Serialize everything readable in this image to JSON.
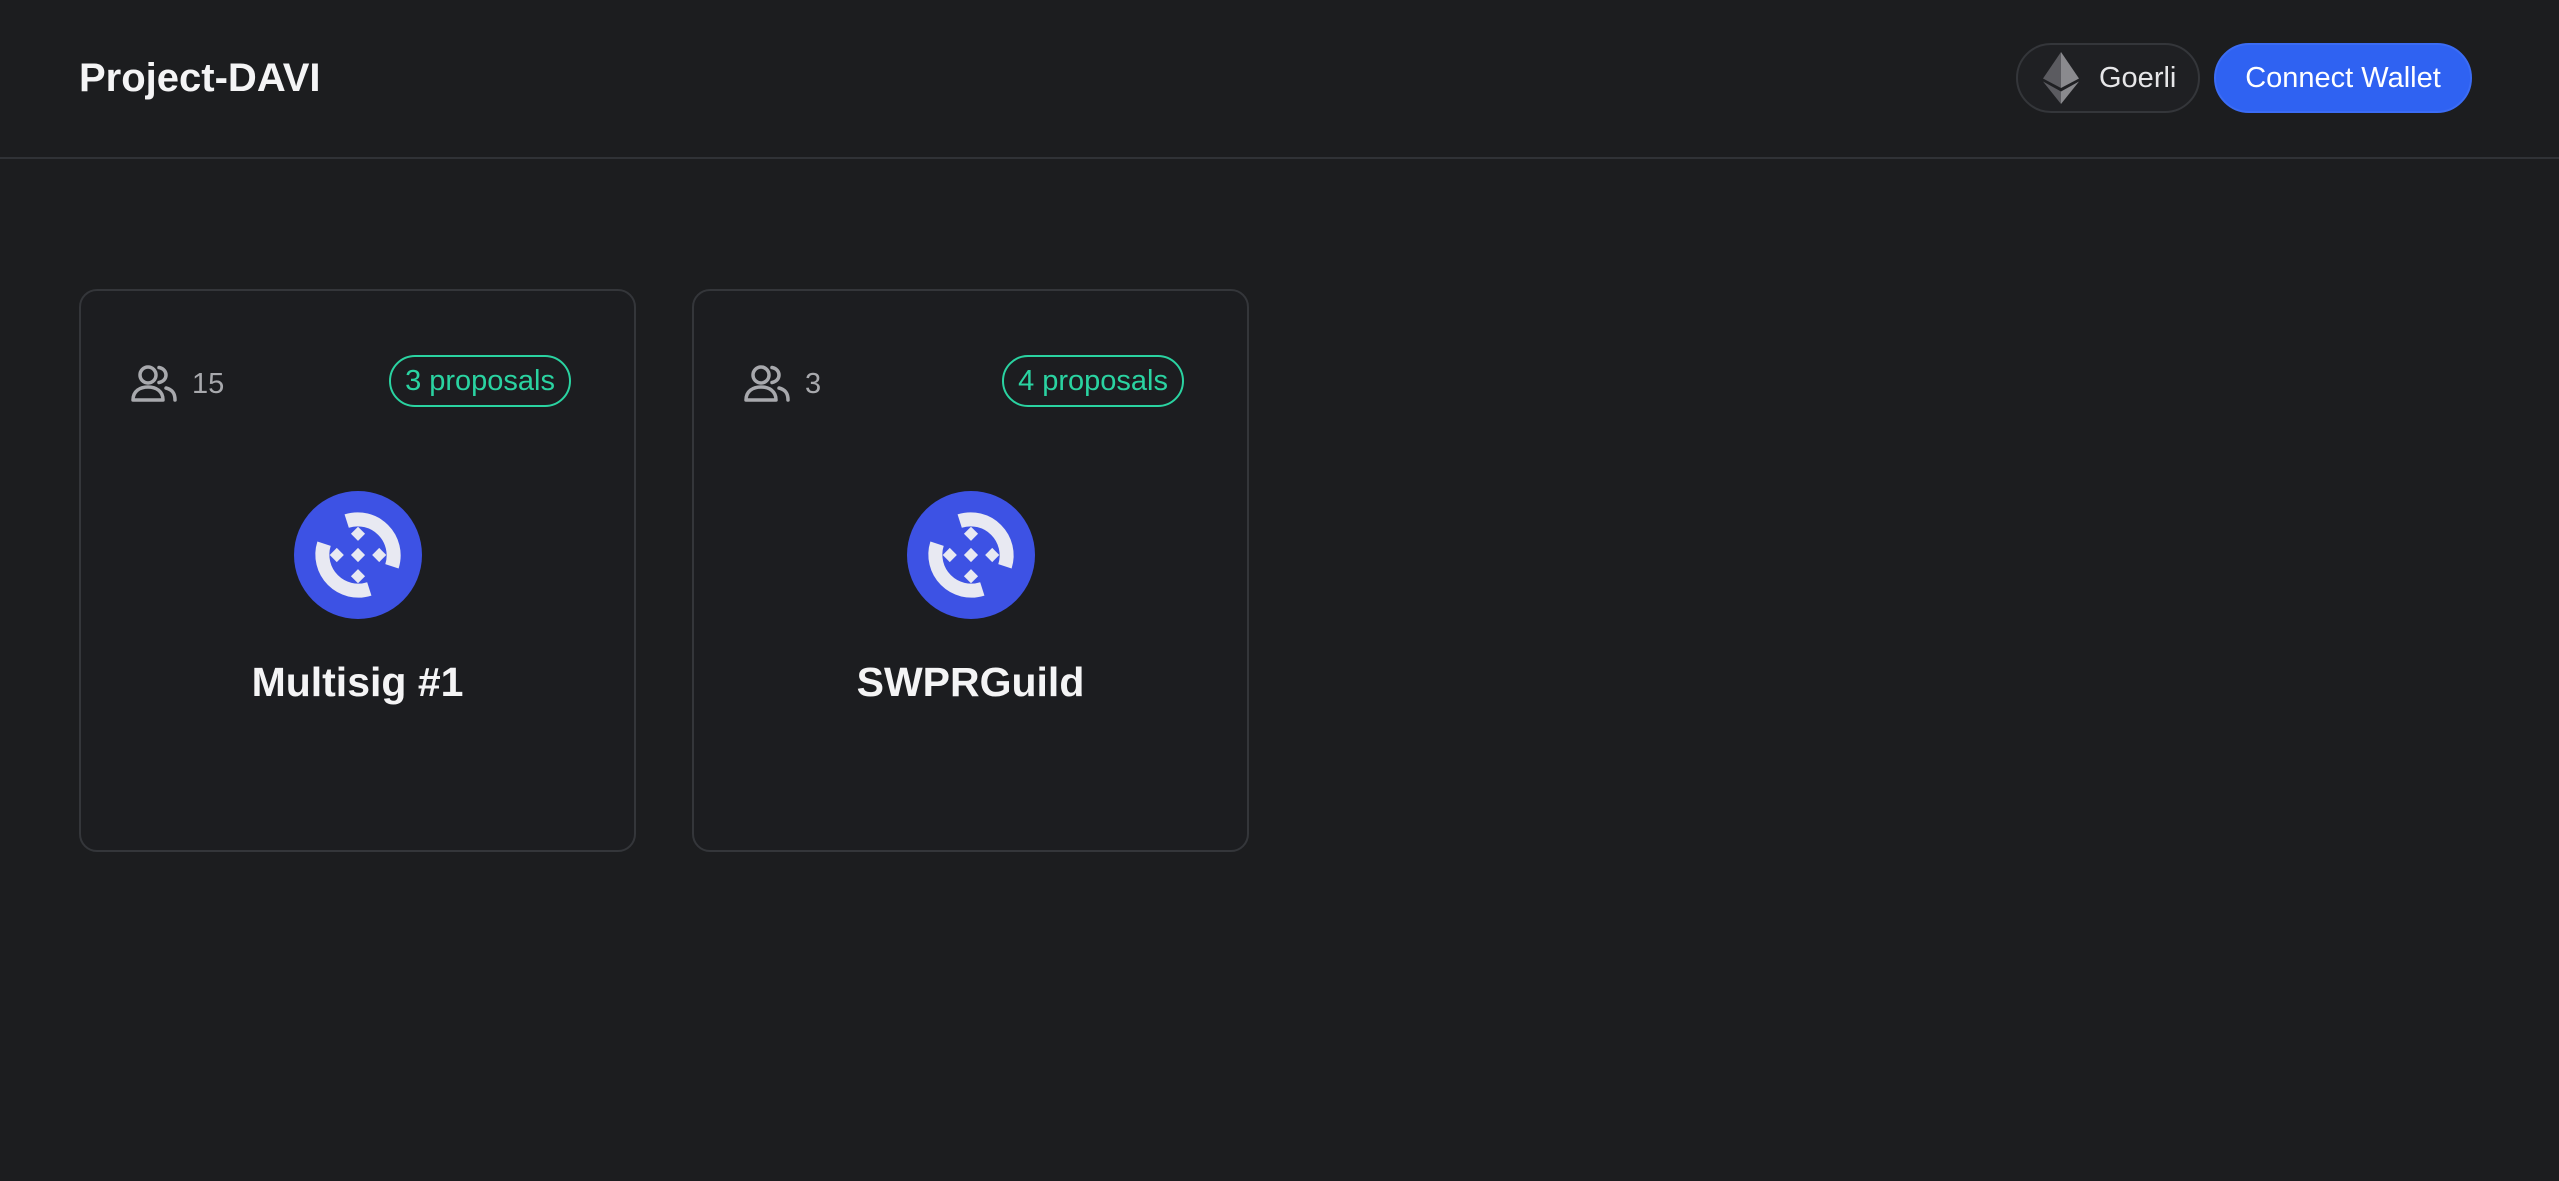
{
  "header": {
    "title": "Project-DAVI",
    "network_label": "Goerli",
    "network_icon": "ethereum-icon",
    "connect_label": "Connect Wallet"
  },
  "colors": {
    "background": "#1c1d1f",
    "accent": "#2f62f2",
    "proposals_badge": "#2ad3a1",
    "logo": "#3d52e4"
  },
  "cards": [
    {
      "name": "Multisig #1",
      "members": "15",
      "proposals": "3 proposals"
    },
    {
      "name": "SWPRGuild",
      "members": "3",
      "proposals": "4 proposals"
    }
  ]
}
